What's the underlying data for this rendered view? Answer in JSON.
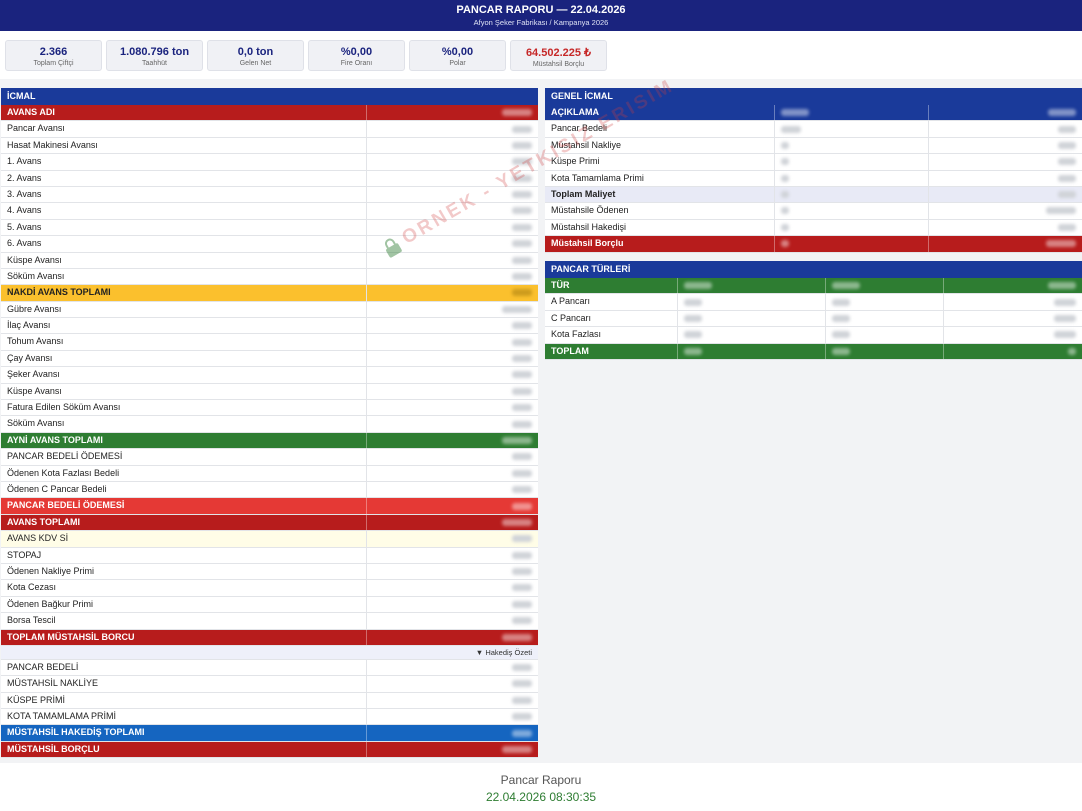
{
  "header": {
    "title": "PANCAR RAPORU — 22.04.2026",
    "subtitle": "Afyon Şeker Fabrikası / Kampanya 2026"
  },
  "stats": [
    {
      "value": "2.366",
      "label": "Toplam Çiftçi"
    },
    {
      "value": "1.080.796 ton",
      "label": "Taahhüt"
    },
    {
      "value": "0,0 ton",
      "label": "Gelen Net"
    },
    {
      "value": "%0,00",
      "label": "Fire Oranı"
    },
    {
      "value": "%0,00",
      "label": "Polar"
    },
    {
      "value": "64.502.225 ₺",
      "label": "Müstahsil Borçlu"
    }
  ],
  "icmal": {
    "title": "İCMAL",
    "header": "AVANS ADI",
    "rows": [
      "Pancar Avansı",
      "Hasat Makinesi Avansı",
      "1. Avans",
      "2. Avans",
      "3. Avans",
      "4. Avans",
      "5. Avans",
      "6. Avans",
      "Küspe Avansı",
      "Söküm Avansı",
      "NAKDİ AVANS TOPLAMI",
      "Gübre Avansı",
      "İlaç Avansı",
      "Tohum Avansı",
      "Çay Avansı",
      "Şeker Avansı",
      "Küspe Avansı",
      "Fatura Edilen Söküm Avansı",
      "Söküm Avansı",
      "AYNİ AVANS TOPLAMI",
      "PANCAR BEDELİ ÖDEMESİ",
      "Ödenen Kota Fazlası Bedeli",
      "Ödenen C Pancar Bedeli",
      "PANCAR BEDELİ ÖDEMESİ",
      "AVANS TOPLAMI",
      "AVANS KDV Sİ",
      "STOPAJ",
      "Ödenen Nakliye Primi",
      "Kota Cezası",
      "Ödenen Bağkur Primi",
      "Borsa Tescil",
      "TOPLAM MÜSTAHSİL BORCU"
    ],
    "toggle_label": "Hakediş Özeti",
    "rows2": [
      "PANCAR BEDELİ",
      "MÜSTAHSİL NAKLİYE",
      "KÜSPE PRİMİ",
      "KOTA TAMAMLAMA PRİMİ",
      "MÜSTAHSİL HAKEDİŞ TOPLAMI",
      "MÜSTAHSİL BORÇLU"
    ]
  },
  "genel": {
    "title": "GENEL İCMAL",
    "header": "AÇIKLAMA",
    "rows": [
      "Pancar Bedeli",
      "Müstahsil Nakliye",
      "Küspe Primi",
      "Kota Tamamlama Primi",
      "Toplam Maliyet",
      "Müstahsile Ödenen",
      "Müstahsil Hakedişi",
      "Müstahsil Borçlu"
    ]
  },
  "turler": {
    "title": "PANCAR TÜRLERİ",
    "header": "TÜR",
    "rows": [
      "A Pancarı",
      "C Pancarı",
      "Kota Fazlası"
    ],
    "total": "TOPLAM"
  },
  "watermark": "ORNEK - YETKISIZ ERISIM",
  "footer": {
    "title": "Pancar Raporu",
    "timestamp": "22.04.2026 08:30:35"
  }
}
